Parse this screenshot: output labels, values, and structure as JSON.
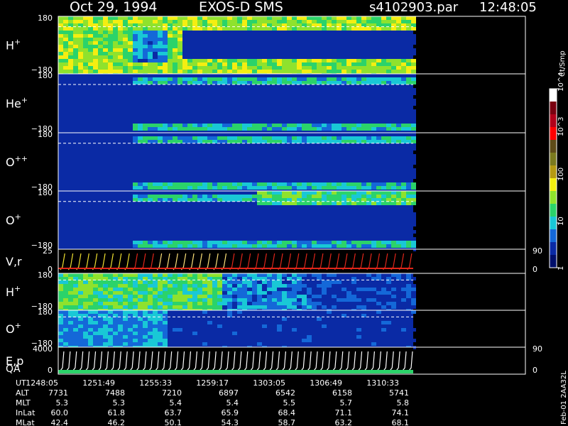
{
  "header": {
    "date": "Oct 29, 1994",
    "instrument": "EXOS-D SMS",
    "file": "s4102903.par",
    "time": "12:48:05"
  },
  "colorbar": {
    "unit": "Ct/Smp",
    "ticks": [
      {
        "label": "1",
        "value": 1
      },
      {
        "label": "10",
        "value": 10
      },
      {
        "label": "100",
        "value": 100
      },
      {
        "label": "10^3",
        "value": 1000
      },
      {
        "label": "10^4",
        "value": 10000
      }
    ],
    "colors": [
      "#000f6b",
      "#0a2aa5",
      "#1468d8",
      "#19c8d6",
      "#2bd36a",
      "#8fe22d",
      "#f4ee11",
      "#b59a12",
      "#7b7a1e",
      "#5e4b18",
      "#ff0000",
      "#b2001a",
      "#7a0010",
      "#ffffff"
    ]
  },
  "panels": [
    {
      "key": "hplus_1",
      "label": "H",
      "sup": "+",
      "ymax": "180",
      "ymin": "−180"
    },
    {
      "key": "heplus",
      "label": "He",
      "sup": "+",
      "ymax": "180",
      "ymin": "−180"
    },
    {
      "key": "oplusplus",
      "label": "O",
      "sup": "++",
      "ymax": "180",
      "ymin": "−180"
    },
    {
      "key": "oplus_1",
      "label": "O",
      "sup": "+",
      "ymax": "180",
      "ymin": "−180"
    },
    {
      "key": "vr",
      "label": "V,r",
      "sup": "",
      "ymax": "25",
      "ymin": "0",
      "right_top": "90",
      "right_bottom": "0"
    },
    {
      "key": "hplus_2",
      "label": "H",
      "sup": "+",
      "ymax": "180",
      "ymin": "−180"
    },
    {
      "key": "oplus_2",
      "label": "O",
      "sup": "+",
      "ymax": "180",
      "ymin": "−180"
    },
    {
      "key": "ep",
      "label": "E,p",
      "sup": "",
      "ymax": "4000",
      "ymin": "0",
      "right_top": "90",
      "right_bottom": "0"
    }
  ],
  "qa_label": "QA",
  "side_label": "Feb-01 2AA32L",
  "ephemeris": {
    "row_labels": [
      "UT",
      "ALT",
      "MLT",
      "InLat",
      "MLat"
    ],
    "columns": [
      {
        "UT": "1248:05",
        "ALT": "7731",
        "MLT": "5.3",
        "InLat": "60.0",
        "MLat": "42.4"
      },
      {
        "UT": "1251:49",
        "ALT": "7488",
        "MLT": "5.3",
        "InLat": "61.8",
        "MLat": "46.2"
      },
      {
        "UT": "1255:33",
        "ALT": "7210",
        "MLT": "5.4",
        "InLat": "63.7",
        "MLat": "50.1"
      },
      {
        "UT": "1259:17",
        "ALT": "6897",
        "MLT": "5.4",
        "InLat": "65.9",
        "MLat": "54.3"
      },
      {
        "UT": "1303:05",
        "ALT": "6542",
        "MLT": "5.5",
        "InLat": "68.4",
        "MLat": "58.7"
      },
      {
        "UT": "1306:49",
        "ALT": "6158",
        "MLT": "5.7",
        "InLat": "71.1",
        "MLat": "63.2"
      },
      {
        "UT": "1310:33",
        "ALT": "5741",
        "MLT": "5.8",
        "InLat": "74.1",
        "MLat": "68.1"
      }
    ]
  },
  "chart_data": {
    "type": "heatmap",
    "title": "Oct 29, 1994 EXOS-D SMS",
    "x_tick_labels": [
      "1248:05",
      "1251:49",
      "1255:33",
      "1259:17",
      "1303:05",
      "1306:49",
      "1310:33"
    ],
    "color_scale": "log",
    "color_range": [
      1,
      10000
    ],
    "series": [
      {
        "name": "H+",
        "y_range": [
          -180,
          180
        ]
      },
      {
        "name": "He+",
        "y_range": [
          -180,
          180
        ]
      },
      {
        "name": "O++",
        "y_range": [
          -180,
          180
        ]
      },
      {
        "name": "O+",
        "y_range": [
          -180,
          180
        ]
      },
      {
        "name": "V,r",
        "y_range": [
          0,
          25
        ]
      },
      {
        "name": "H+",
        "y_range": [
          -180,
          180
        ]
      },
      {
        "name": "O+",
        "y_range": [
          -180,
          180
        ]
      },
      {
        "name": "E,p",
        "y_range": [
          0,
          4000
        ]
      }
    ]
  }
}
